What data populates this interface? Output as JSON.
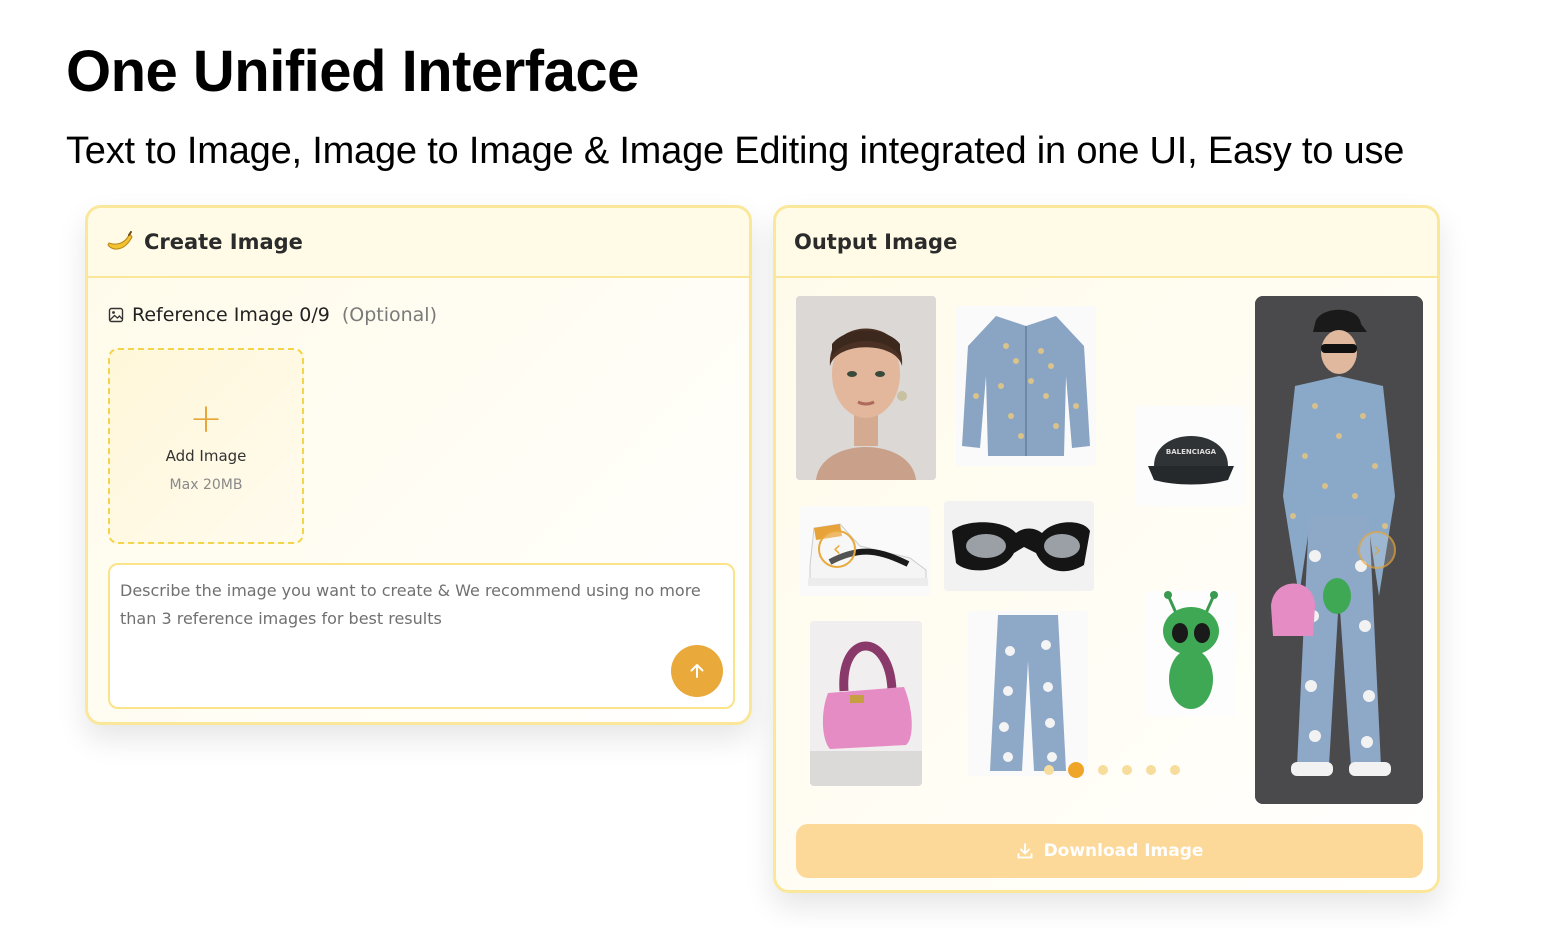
{
  "hero": {
    "title": "One Unified Interface",
    "subtitle": "Text to Image, Image to Image & Image Editing integrated in one UI, Easy to use"
  },
  "create_panel": {
    "title": "Create Image",
    "icon": "banana-icon",
    "reference_label": "Reference Image 0/9",
    "reference_optional": "(Optional)",
    "upload": {
      "title": "Add Image",
      "limit": "Max 20MB"
    },
    "prompt_placeholder": "Describe the image you want to create & We recommend using no more than 3 reference images for best results",
    "send_icon": "arrow-up-icon"
  },
  "output_panel": {
    "title": "Output Image",
    "thumbnails": [
      "portrait",
      "denim-jacket",
      "black-cap",
      "sneaker",
      "sunglasses",
      "pink-handbag",
      "floral-jeans",
      "green-alien-toy",
      "styled-result"
    ],
    "cap_text": "BALENCIAGA",
    "carousel": {
      "total": 6,
      "active_index": 1
    },
    "download_label": "Download Image"
  },
  "colors": {
    "accent": "#e9a93b",
    "border": "#fbe79a",
    "panel_bg": "#fffbea",
    "download_bg": "#fcd999"
  }
}
